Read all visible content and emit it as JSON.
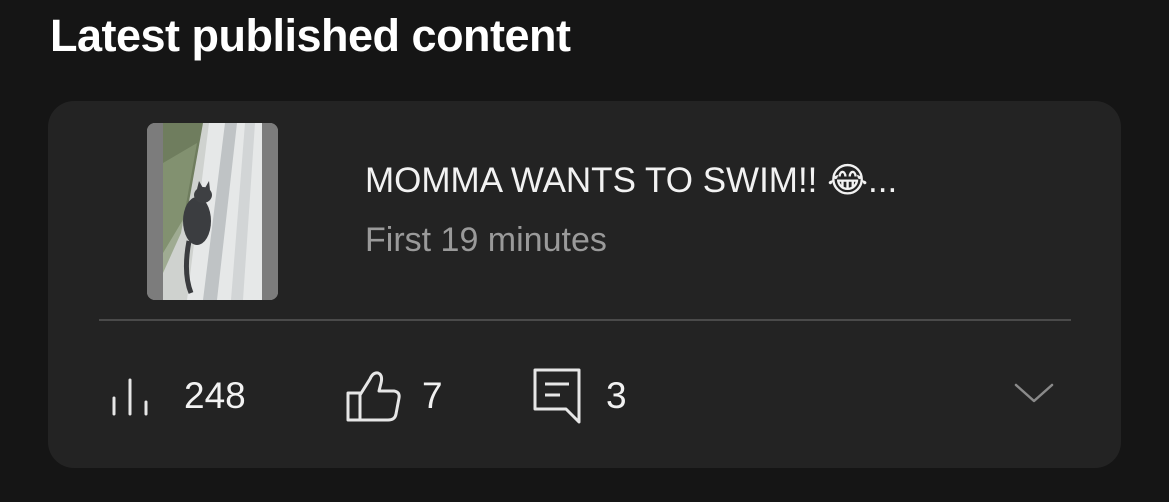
{
  "section": {
    "title": "Latest published content"
  },
  "video": {
    "thumbnail_icon": "video-thumbnail",
    "title": "MOMMA WANTS TO SWIM!! 😂...",
    "subtitle": "First 19 minutes"
  },
  "stats": {
    "views": "248",
    "likes": "7",
    "comments": "3"
  },
  "icons": {
    "views": "bar-chart-icon",
    "likes": "thumbs-up-icon",
    "comments": "comment-icon",
    "expand": "chevron-down-icon"
  },
  "colors": {
    "background": "#151515",
    "card": "#232323",
    "text": "#ffffff",
    "muted": "#9a9a9a"
  }
}
